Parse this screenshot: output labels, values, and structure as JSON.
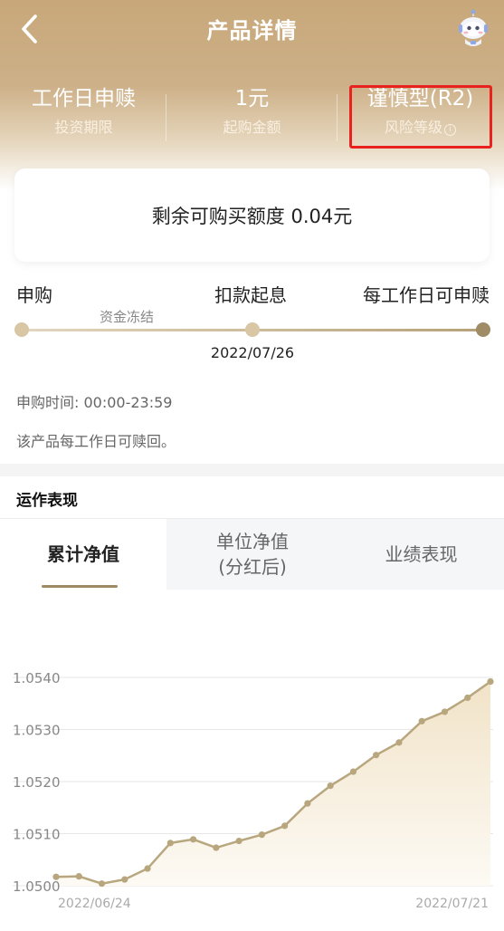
{
  "header": {
    "title": "产品详情",
    "back_icon": "chevron-left-icon",
    "assistant_icon": "robot-assistant-icon"
  },
  "stats": [
    {
      "value": "工作日申赎",
      "label": "投资期限"
    },
    {
      "value": "1元",
      "label": "起购金额"
    },
    {
      "value": "谨慎型(R2)",
      "label": "风险等级",
      "highlight_color": "#e8221e"
    }
  ],
  "quota": {
    "text": "剩余可购买额度 0.04元"
  },
  "process": {
    "steps": [
      "申购",
      "扣款起息",
      "每工作日可申赎"
    ],
    "sub_label": "资金冻结",
    "date": "2022/07/26"
  },
  "notes": {
    "purchase_time": "申购时间: 00:00-23:59",
    "redeem_note": "该产品每工作日可赎回。"
  },
  "performance": {
    "title": "运作表现",
    "tabs": [
      {
        "label": "累计净值",
        "active": true
      },
      {
        "label": "单位净值\n(分红后)",
        "active": false
      },
      {
        "label": "业绩表现",
        "active": false
      }
    ]
  },
  "chart_data": {
    "type": "area",
    "x_start_label": "2022/06/24",
    "x_end_label": "2022/07/21",
    "y_ticks": [
      "1.0540",
      "1.0530",
      "1.0520",
      "1.0510",
      "1.0500"
    ],
    "ylim": [
      1.05,
      1.054
    ],
    "values": [
      1.05017,
      1.05018,
      1.05004,
      1.05012,
      1.05033,
      1.05082,
      1.05089,
      1.05073,
      1.05086,
      1.05098,
      1.05115,
      1.05158,
      1.05192,
      1.05219,
      1.05251,
      1.05275,
      1.05316,
      1.05334,
      1.05361,
      1.05392
    ],
    "colors": {
      "line": "#b8a77e",
      "fill_top": "#f1e3c8",
      "fill_bottom": "#fdfaf4",
      "grid": "#e7e7e7"
    }
  }
}
